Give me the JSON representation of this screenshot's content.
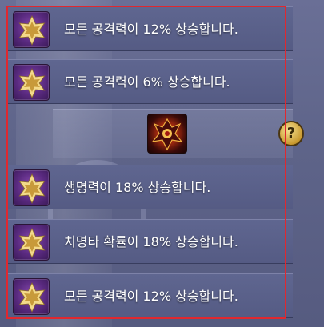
{
  "effects": [
    {
      "label": "모든 공격력이 12% 상승합니다.",
      "icon": "purple-star-icon"
    },
    {
      "label": "모든 공격력이 6% 상승합니다.",
      "icon": "purple-star-icon"
    },
    {
      "label": "생명력이 18% 상승합니다.",
      "icon": "purple-star-icon"
    },
    {
      "label": "치명타 확률이 18% 상승합니다.",
      "icon": "purple-star-icon"
    },
    {
      "label": "모든 공격력이 12% 상승합니다.",
      "icon": "purple-star-icon"
    }
  ],
  "slot": {
    "item_icon": "demon-mask-icon",
    "help_label": "?"
  },
  "colors": {
    "highlight_frame": "#e0282f",
    "row_bg": "#5f6690",
    "star_gold": "#f3d98a"
  }
}
